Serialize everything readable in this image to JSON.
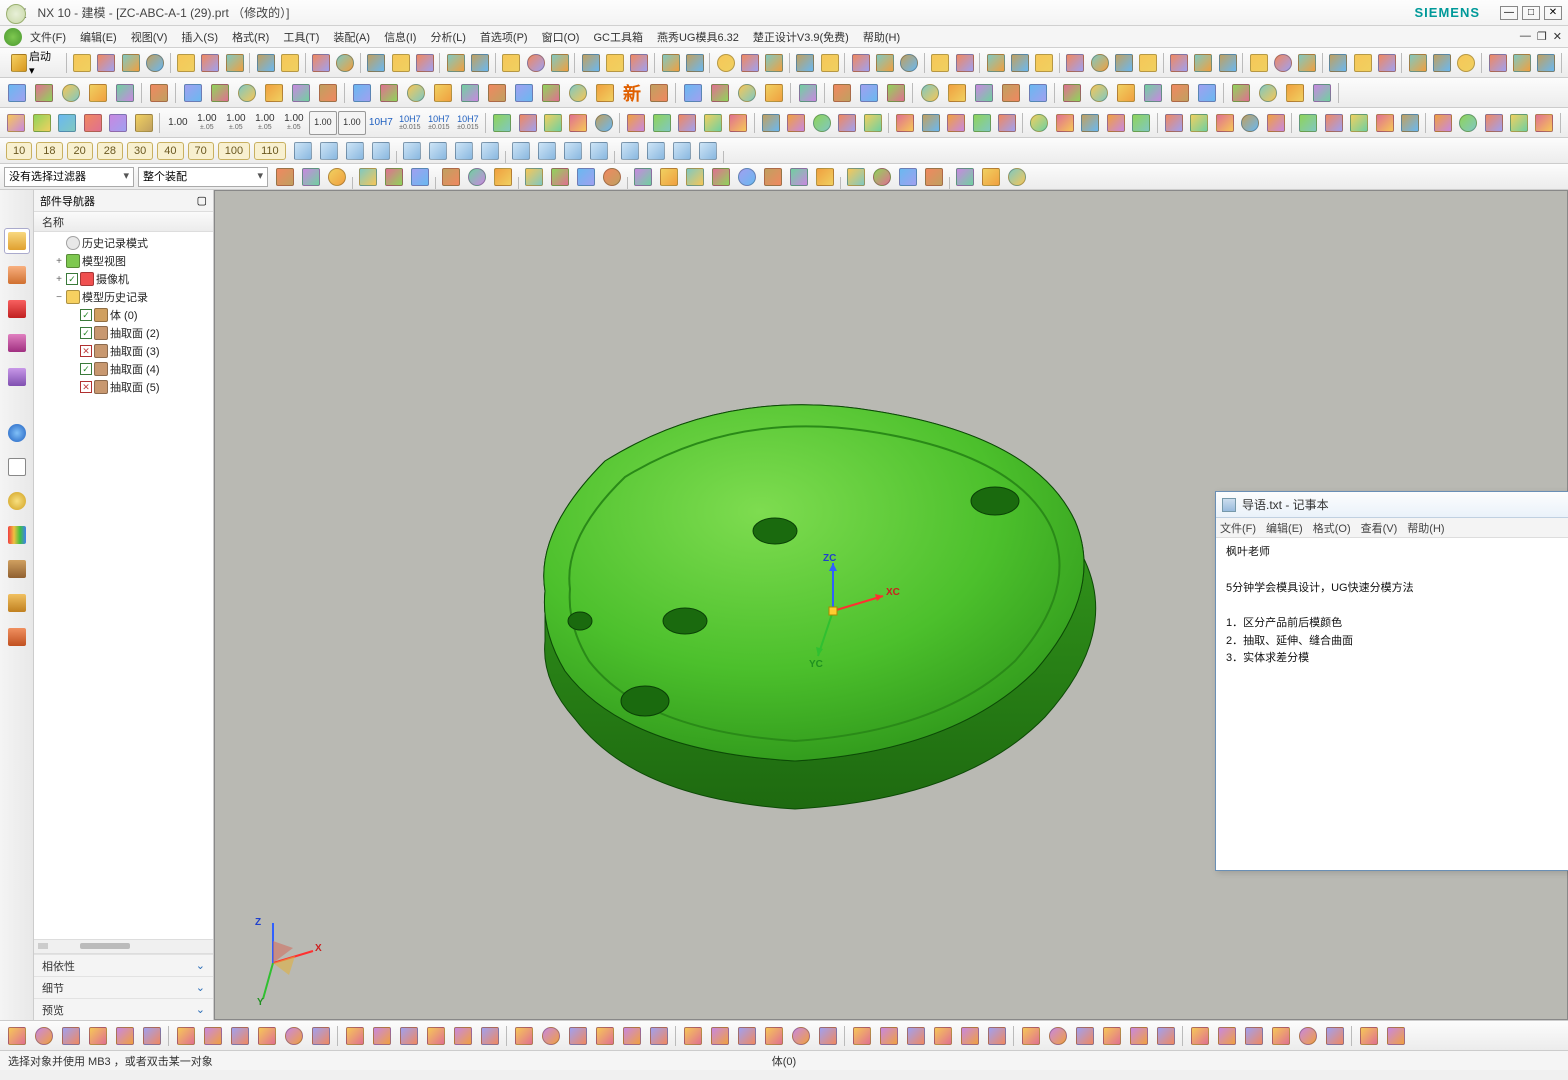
{
  "app": {
    "nx": "NX",
    "title": "NX 10 - 建模 - [ZC-ABC-A-1 (29).prt （修改的）]",
    "siemens": "SIEMENS"
  },
  "menus": [
    "文件(F)",
    "编辑(E)",
    "视图(V)",
    "插入(S)",
    "格式(R)",
    "工具(T)",
    "装配(A)",
    "信息(I)",
    "分析(L)",
    "首选项(P)",
    "窗口(O)",
    "GC工具箱",
    "燕秀UG模具6.32",
    "楚正设计V3.9(免费)",
    "帮助(H)"
  ],
  "launch": "启动",
  "dims": [
    "1.00",
    "1.00\n±.05",
    "1.00\n±.05",
    "1.00\n±.05",
    "1.00\n±.05",
    "1.00",
    "1.00",
    "10H7",
    "10H7\n±0.015",
    "10H7\n±0.015",
    "10H7\n±0.015"
  ],
  "numbers": [
    "10",
    "18",
    "20",
    "28",
    "30",
    "40",
    "70",
    "100",
    "110"
  ],
  "filter": {
    "no_sel": "没有选择过滤器",
    "assy": "整个装配"
  },
  "nav": {
    "header": "部件导航器",
    "col": "名称",
    "items": [
      {
        "indent": 1,
        "exp": "",
        "ico": "clock",
        "label": "历史记录模式"
      },
      {
        "indent": 1,
        "exp": "+",
        "ico": "cube-g",
        "label": "模型视图"
      },
      {
        "indent": 1,
        "exp": "+",
        "ico": "cam",
        "check": true,
        "label": "摄像机"
      },
      {
        "indent": 1,
        "exp": "−",
        "ico": "folder",
        "label": "模型历史记录"
      },
      {
        "indent": 2,
        "exp": "",
        "check": true,
        "ico": "body",
        "label": "体 (0)"
      },
      {
        "indent": 2,
        "exp": "",
        "check": true,
        "ico": "extract",
        "label": "抽取面 (2)"
      },
      {
        "indent": 2,
        "exp": "",
        "check": false,
        "ico": "extract",
        "label": "抽取面 (3)"
      },
      {
        "indent": 2,
        "exp": "",
        "check": true,
        "ico": "extract",
        "label": "抽取面 (4)"
      },
      {
        "indent": 2,
        "exp": "",
        "check": false,
        "ico": "extract",
        "label": "抽取面 (5)"
      }
    ],
    "acc": [
      "相依性",
      "细节",
      "预览"
    ]
  },
  "axes": {
    "xc": "XC",
    "yc": "YC",
    "zc": "ZC",
    "x": "X",
    "y": "Y",
    "z": "Z"
  },
  "notepad": {
    "title": "导语.txt - 记事本",
    "menus": [
      "文件(F)",
      "编辑(E)",
      "格式(O)",
      "查看(V)",
      "帮助(H)"
    ],
    "l1": "枫叶老师",
    "l2": "5分钟学会模具设计，UG快速分模方法",
    "l3": "1．区分产品前后模颜色",
    "l4": "2．抽取、延伸、缝合曲面",
    "l5": "3．实体求差分模"
  },
  "status": {
    "left": "选择对象并使用 MB3 ，或者双击某一对象",
    "mid": "体(0)"
  },
  "new_char": "新"
}
